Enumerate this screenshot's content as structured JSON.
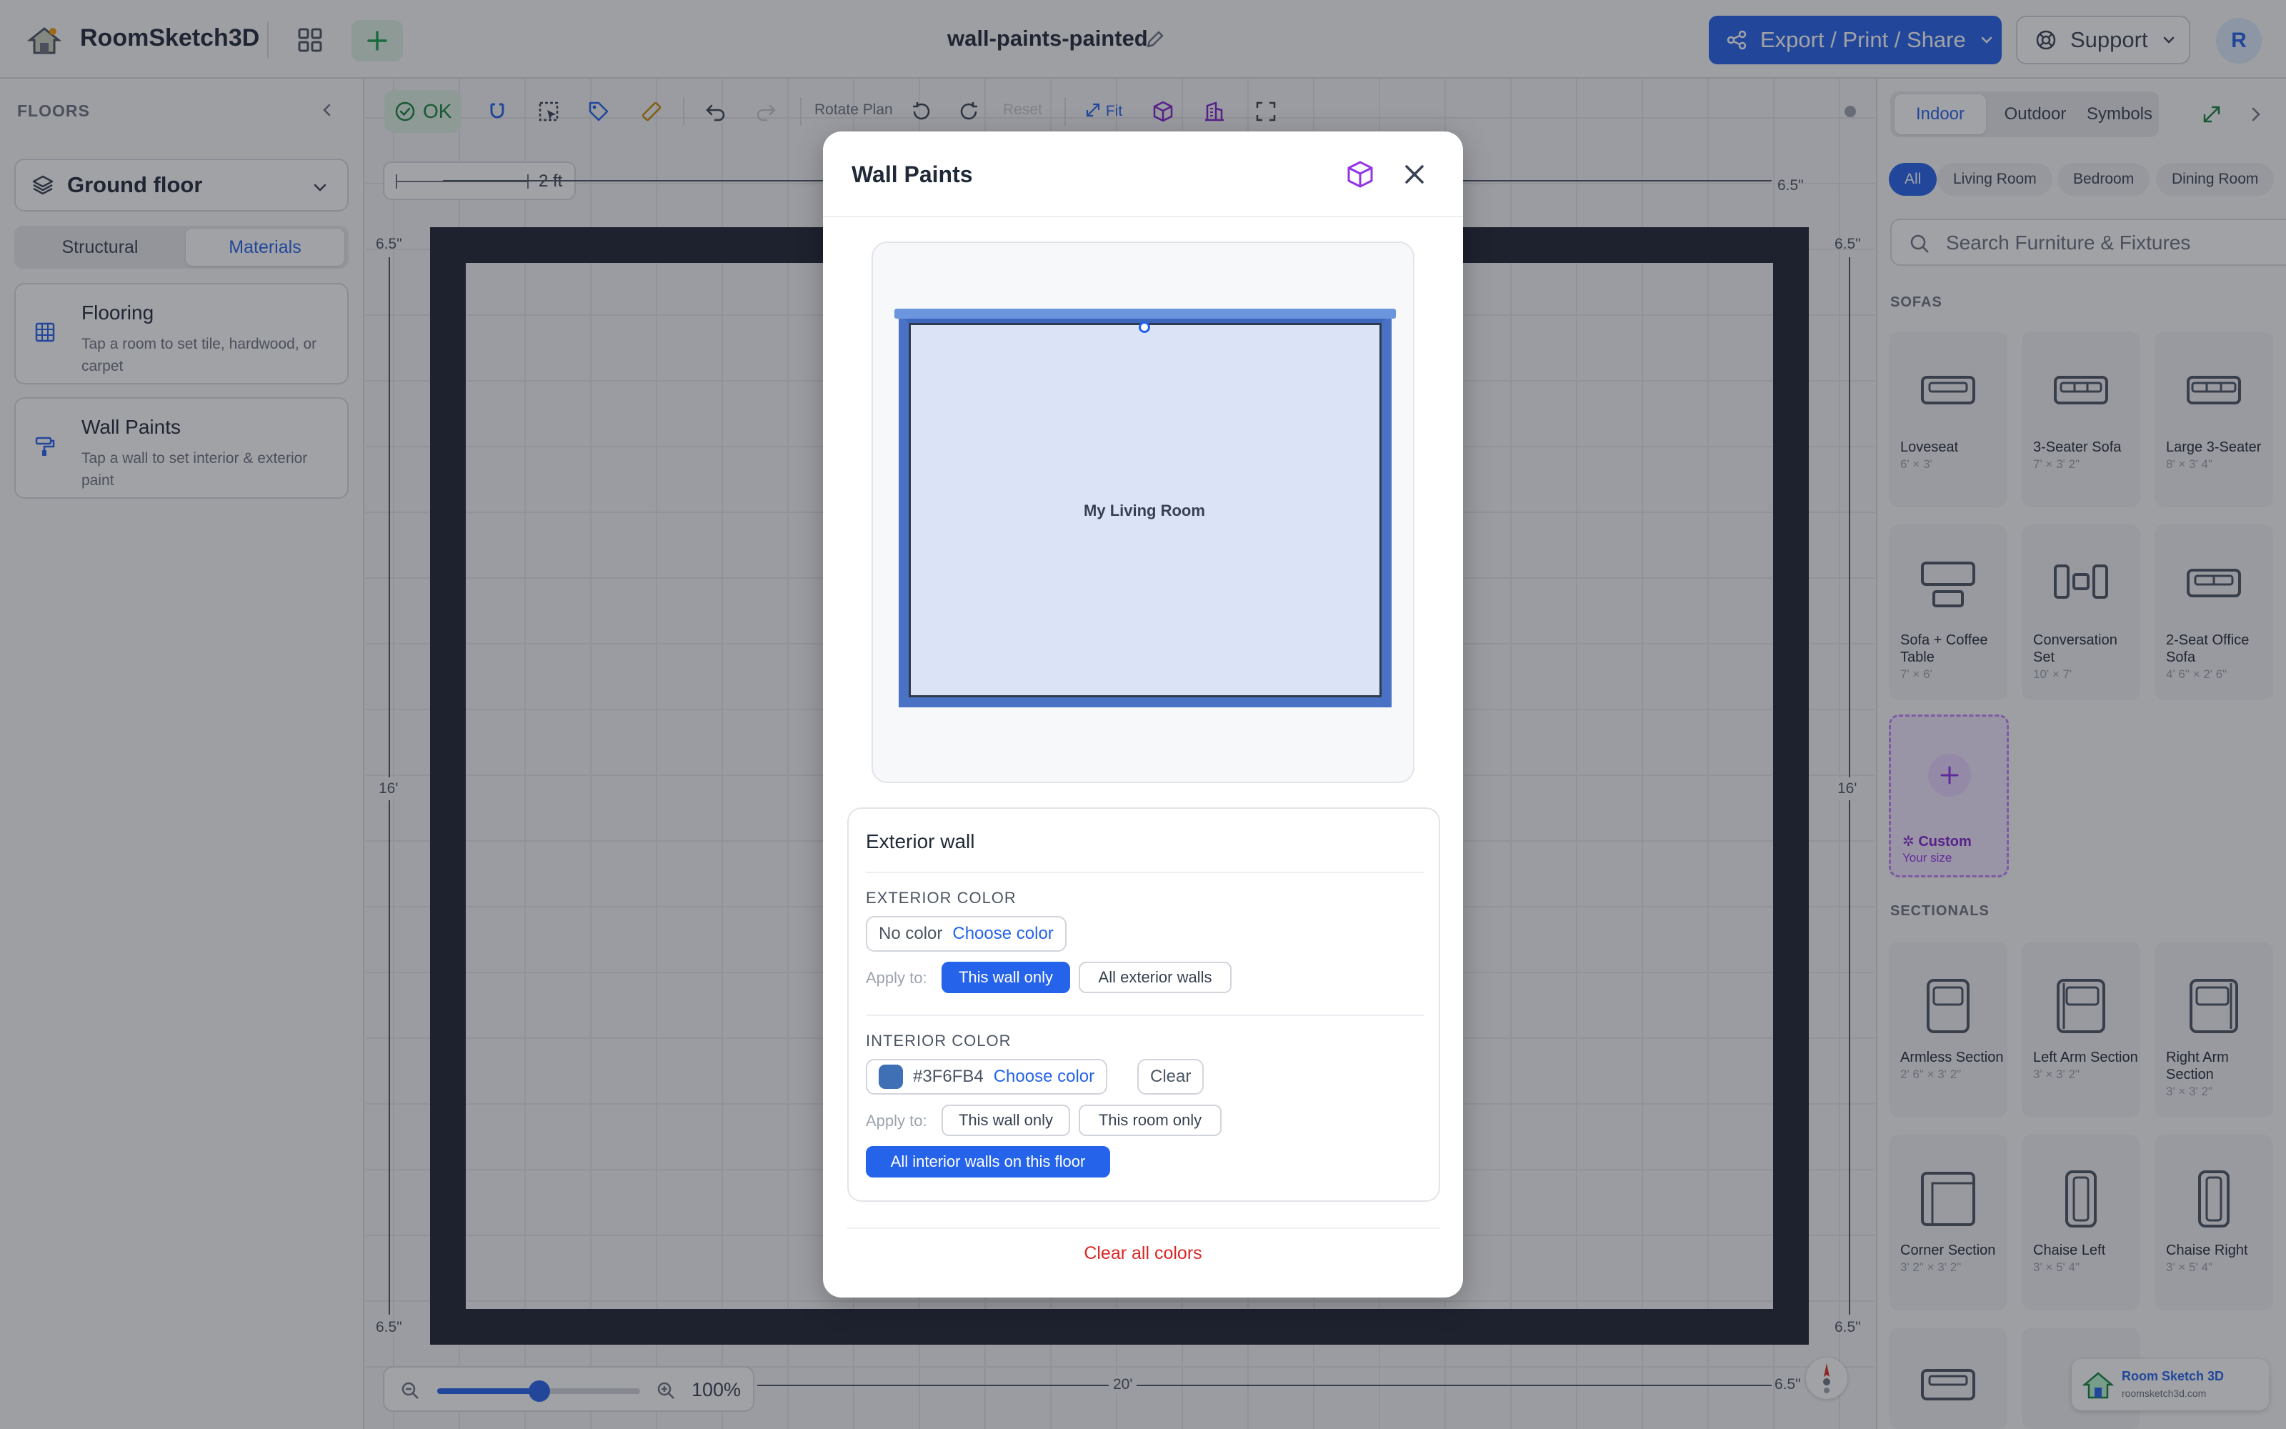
{
  "app": {
    "name": "RoomSketch3D",
    "doc_title": "wall-paints-painted",
    "avatar_initial": "R"
  },
  "header": {
    "export_label": "Export / Print / Share",
    "support_label": "Support"
  },
  "sidebar": {
    "floors_label": "FLOORS",
    "floor_name": "Ground floor",
    "tabs": [
      "Structural",
      "Materials"
    ],
    "active_tab": "Materials",
    "cards": [
      {
        "title": "Flooring",
        "desc": "Tap a room to set tile, hardwood, or carpet"
      },
      {
        "title": "Wall Paints",
        "desc": "Tap a wall to set interior & exterior paint"
      }
    ]
  },
  "toolbar": {
    "ok_label": "OK",
    "rotate_label": "Rotate Plan",
    "reset_label": "Reset",
    "fit_label": "Fit"
  },
  "canvas": {
    "scale_label": "2 ft",
    "dims": {
      "corner": "6.5\"",
      "height": "16'",
      "width": "20'"
    },
    "zoom_percent": "100%",
    "zoom_level": 0.5
  },
  "right_panel": {
    "tabs": [
      "Indoor",
      "Outdoor",
      "Symbols"
    ],
    "chips": [
      "All",
      "Living Room",
      "Bedroom",
      "Dining Room"
    ],
    "search_placeholder": "Search Furniture & Fixtures",
    "sections": [
      {
        "label": "SOFAS",
        "items": [
          {
            "name": "Loveseat",
            "size": "6' × 3'"
          },
          {
            "name": "3-Seater Sofa",
            "size": "7' × 3' 2\""
          },
          {
            "name": "Large 3-Seater",
            "size": "8' × 3' 4\""
          },
          {
            "name": "Sofa + Coffee Table",
            "size": "7' × 6'"
          },
          {
            "name": "Conversation Set",
            "size": "10' × 7'"
          },
          {
            "name": "2-Seat Office Sofa",
            "size": "4' 6\" × 2' 6\""
          }
        ]
      },
      {
        "label": "SECTIONALS",
        "items": [
          {
            "name": "Armless Section",
            "size": "2' 6\" × 3' 2\""
          },
          {
            "name": "Left Arm Section",
            "size": "3' × 3' 2\""
          },
          {
            "name": "Right Arm Section",
            "size": "3' × 3' 2\""
          },
          {
            "name": "Corner Section",
            "size": "3' 2\" × 3' 2\""
          },
          {
            "name": "Chaise Left",
            "size": "3' × 5' 4\""
          },
          {
            "name": "Chaise Right",
            "size": "3' × 5' 4\""
          }
        ]
      }
    ],
    "custom": {
      "name": "Custom",
      "sub": "Your size"
    }
  },
  "badge": {
    "name": "Room Sketch 3D",
    "url": "roomsketch3d.com"
  },
  "modal": {
    "title": "Wall Paints",
    "room_label": "My Living Room",
    "card_title": "Exterior wall",
    "exterior": {
      "heading": "EXTERIOR COLOR",
      "value": "No color",
      "choose_label": "Choose color",
      "apply_label": "Apply to:",
      "options": [
        "This wall only",
        "All exterior walls"
      ],
      "selected": "This wall only"
    },
    "interior": {
      "heading": "INTERIOR COLOR",
      "hex": "#3F6FB4",
      "choose_label": "Choose color",
      "clear_label": "Clear",
      "apply_label": "Apply to:",
      "options": [
        "This wall only",
        "This room only",
        "All interior walls on this floor"
      ],
      "selected": "All interior walls on this floor"
    },
    "clear_all_label": "Clear all colors"
  },
  "colors": {
    "accent": "#2563eb",
    "wall": "#1e2432",
    "interior_swatch": "#3F6FB4",
    "danger": "#dc2626"
  }
}
